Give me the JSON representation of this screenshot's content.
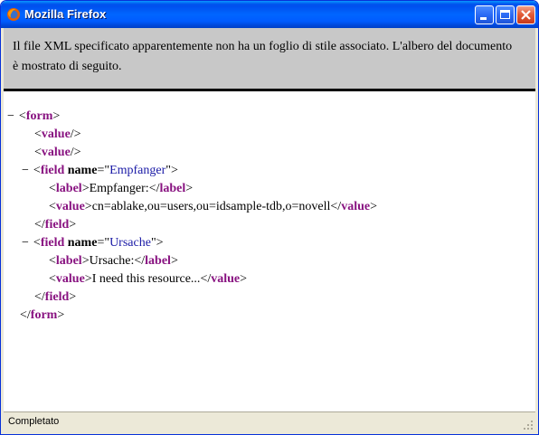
{
  "window": {
    "title": "Mozilla Firefox"
  },
  "notice": {
    "text": "Il file XML specificato apparentemente non ha un foglio di stile associato. L'albero del documento è mostrato di seguito."
  },
  "tree": {
    "minus": "−",
    "lt": "<",
    "gt": ">",
    "lt_slash": "</",
    "empty_close": "/>",
    "eq_quote": "=\"",
    "quote_gt": "\">",
    "tags": {
      "form": "form",
      "value": "value",
      "field": "field",
      "label": "label"
    },
    "attr_name": "name",
    "field1_name": "Empfanger",
    "field1_label_text": "Empfanger:",
    "field1_value_text": "cn=ablake,ou=users,ou=idsample-tdb,o=novell",
    "field2_name": "Ursache",
    "field2_label_text": "Ursache:",
    "field2_value_text": "I need this resource..."
  },
  "status": {
    "text": "Completato"
  }
}
